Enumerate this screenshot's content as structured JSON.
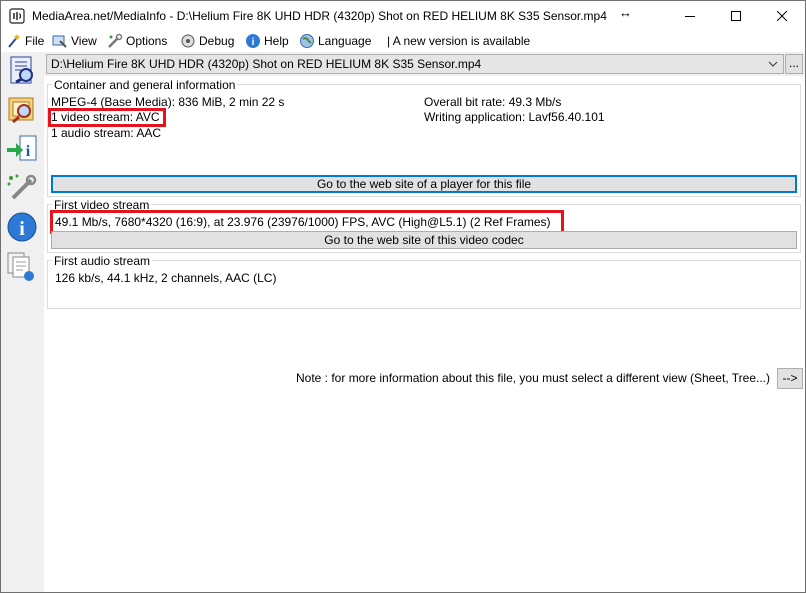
{
  "window": {
    "title": "MediaArea.net/MediaInfo - D:\\Helium Fire 8K UHD HDR (4320p)   Shot on RED HELIUM 8K S35 Sensor.mp4",
    "resize_glyph": "↔"
  },
  "menu": {
    "items": [
      {
        "label": "File",
        "icon": "file-wand-icon"
      },
      {
        "label": "View",
        "icon": "view-icon"
      },
      {
        "label": "Options",
        "icon": "options-icon"
      },
      {
        "label": "Debug",
        "icon": "debug-icon"
      },
      {
        "label": "Help",
        "icon": "help-icon"
      },
      {
        "label": "Language",
        "icon": "globe-icon"
      }
    ],
    "notice": "| A new version is available"
  },
  "file_selector": {
    "value": "D:\\Helium Fire 8K UHD HDR (4320p)   Shot on RED HELIUM 8K S35 Sensor.mp4",
    "browse_label": "..."
  },
  "general": {
    "heading": "Container and general information",
    "format_line": "MPEG-4 (Base Media): 836 MiB, 2 min 22 s",
    "video_line": "1 video stream: AVC",
    "audio_line": "1 audio stream: AAC",
    "bitrate_line": "Overall bit rate: 49.3 Mb/s",
    "writing_app_line": "Writing application: Lavf56.40.101",
    "player_button": "Go to the web site of a player for this file"
  },
  "video": {
    "heading": "First video stream",
    "details": "49.1 Mb/s, 7680*4320 (16:9), at 23.976 (23976/1000) FPS, AVC (High@L5.1) (2 Ref Frames)",
    "codec_button": "Go to the web site of this video codec"
  },
  "audio": {
    "heading": "First audio stream",
    "details": "126 kb/s, 44.1 kHz, 2 channels, AAC (LC)"
  },
  "note": {
    "text": "Note : for more information about this file, you must select a different view (Sheet, Tree...)",
    "button": "-->"
  },
  "colors": {
    "highlight": "#e3141e",
    "focus": "#0078d7"
  }
}
